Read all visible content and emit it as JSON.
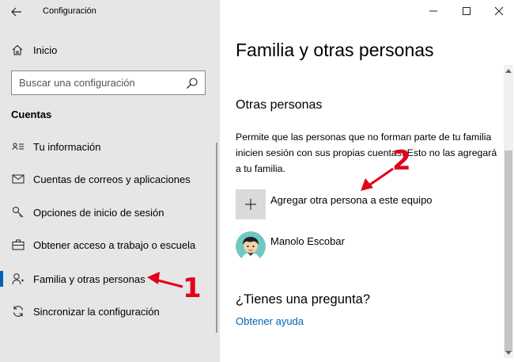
{
  "window": {
    "title": "Configuración",
    "controls": {
      "minimize_icon": "minimize-icon",
      "maximize_icon": "maximize-icon",
      "close_icon": "close-icon"
    }
  },
  "sidebar": {
    "home_label": "Inicio",
    "search_placeholder": "Buscar una configuración",
    "section_title": "Cuentas",
    "items": [
      {
        "label": "Tu información",
        "icon": "contact-card-icon"
      },
      {
        "label": "Cuentas de correos y aplicaciones",
        "icon": "mail-icon"
      },
      {
        "label": "Opciones de inicio de sesión",
        "icon": "key-icon"
      },
      {
        "label": "Obtener acceso a trabajo o escuela",
        "icon": "briefcase-icon"
      },
      {
        "label": "Familia y otras personas",
        "icon": "person-add-icon",
        "selected": true
      },
      {
        "label": "Sincronizar la configuración",
        "icon": "sync-icon"
      }
    ]
  },
  "main": {
    "title": "Familia y otras personas",
    "section_title": "Otras personas",
    "description": "Permite que las personas que no forman parte de tu familia inicien sesión con sus propias cuentas. Esto no las agregará a tu familia.",
    "add_label": "Agregar otra persona a este equipo",
    "users": [
      {
        "name": "Manolo Escobar",
        "icon": "user-avatar"
      }
    ],
    "question": "¿Tienes una pregunta?",
    "help_link": "Obtener ayuda"
  },
  "annotations": {
    "step1": "1",
    "step2": "2"
  },
  "colors": {
    "accent": "#0063b1",
    "sidebar_bg": "#e6e6e6",
    "annotation": "#e3001b",
    "tile_bg": "#dadada"
  }
}
